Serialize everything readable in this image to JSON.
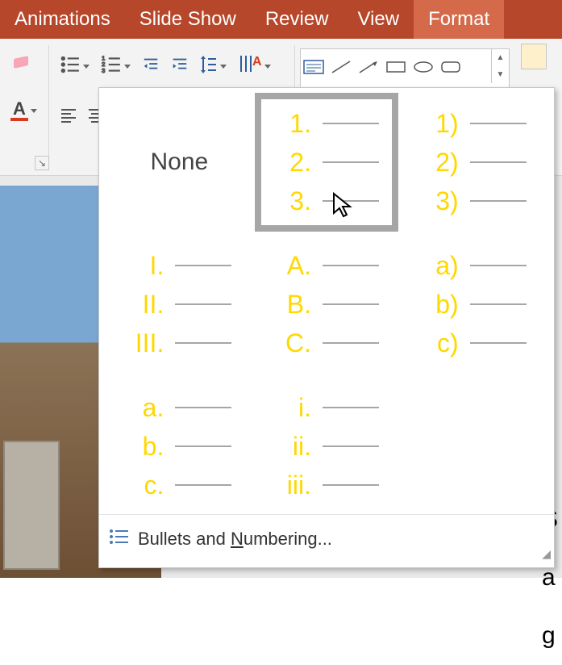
{
  "tabs": {
    "animations": "Animations",
    "slide_show": "Slide Show",
    "review": "Review",
    "view": "View",
    "format": "Format"
  },
  "numbering_popup": {
    "none_label": "None",
    "options": [
      {
        "id": "none",
        "labels": []
      },
      {
        "id": "arabic-period",
        "labels": [
          "1.",
          "2.",
          "3."
        ]
      },
      {
        "id": "arabic-paren",
        "labels": [
          "1)",
          "2)",
          "3)"
        ]
      },
      {
        "id": "upper-roman",
        "labels": [
          "I.",
          "II.",
          "III."
        ]
      },
      {
        "id": "upper-alpha",
        "labels": [
          "A.",
          "B.",
          "C."
        ]
      },
      {
        "id": "lower-alpha-paren",
        "labels": [
          "a)",
          "b)",
          "c)"
        ]
      },
      {
        "id": "lower-alpha-period",
        "labels": [
          "a.",
          "b.",
          "c."
        ]
      },
      {
        "id": "lower-roman",
        "labels": [
          "i.",
          "ii.",
          "iii."
        ]
      }
    ],
    "footer_prefix": "Bullets and ",
    "footer_n": "N",
    "footer_suffix": "umbering..."
  },
  "right_text": {
    "l1": "S",
    "l2": "a",
    "l3": "g"
  },
  "colors": {
    "ribbon_tab_bg": "#b7472a",
    "numbering_yellow": "#ffd800",
    "font_color_bar": "#d63b1e"
  }
}
